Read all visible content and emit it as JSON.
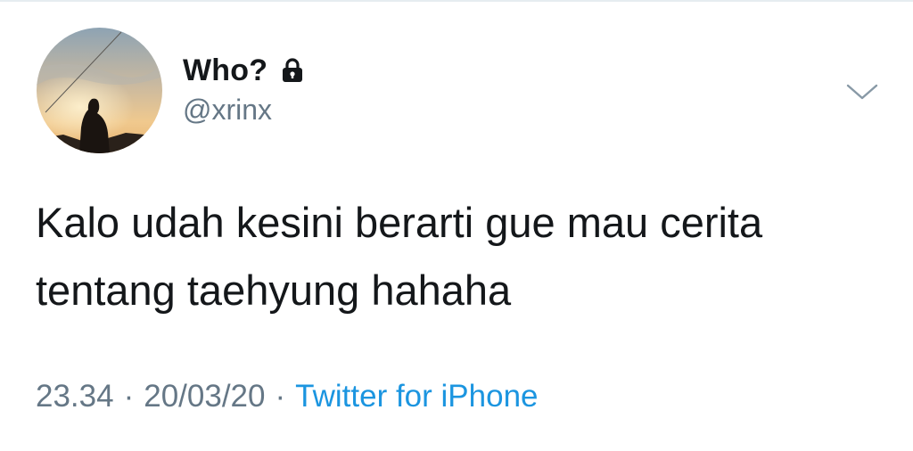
{
  "tweet": {
    "author": {
      "display_name": "Who?",
      "handle": "@xrinx",
      "protected_icon": "lock-icon",
      "avatar": "silhouette-sunset-photo"
    },
    "menu_icon": "chevron-down-icon",
    "text_line1": "Kalo udah kesini berarti gue mau cerita",
    "text_line2": "tentang taehyung hahaha",
    "time": "23.34",
    "date": "20/03/20",
    "separator": "·",
    "source": "Twitter for iPhone"
  },
  "colors": {
    "text_primary": "#14171a",
    "text_secondary": "#657786",
    "link": "#1b95e0",
    "divider": "#e6ecf0"
  }
}
